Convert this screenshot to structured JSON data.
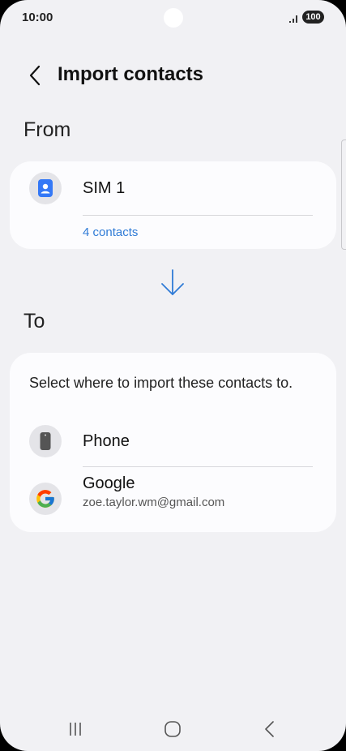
{
  "status_bar": {
    "time": "10:00",
    "battery": "100"
  },
  "header": {
    "title": "Import contacts"
  },
  "from_section": {
    "heading": "From",
    "source": {
      "label": "SIM 1",
      "count": "4 contacts",
      "icon": "sim-contact-icon"
    }
  },
  "to_section": {
    "heading": "To",
    "instruction": "Select where to import these contacts to.",
    "options": [
      {
        "label": "Phone",
        "sub": "",
        "icon": "phone-device-icon"
      },
      {
        "label": "Google",
        "sub": "zoe.taylor.wm@gmail.com",
        "icon": "google-icon"
      }
    ]
  },
  "colors": {
    "background": "#f1f1f4",
    "card": "#fcfcfe",
    "accent": "#2f7bd6",
    "sim_icon": "#3478f6"
  }
}
